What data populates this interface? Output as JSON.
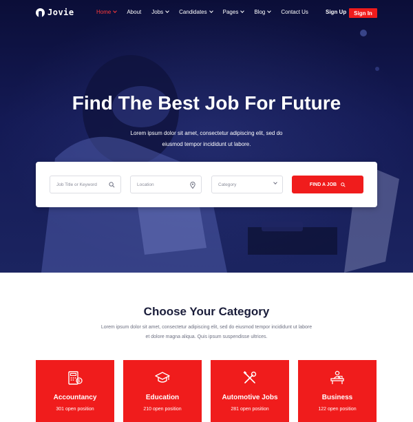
{
  "brand": {
    "name": "Jovie"
  },
  "nav": {
    "items": [
      {
        "label": "Home",
        "active": true,
        "dropdown": true
      },
      {
        "label": "About",
        "active": false,
        "dropdown": false
      },
      {
        "label": "Jobs",
        "active": false,
        "dropdown": true
      },
      {
        "label": "Candidates",
        "active": false,
        "dropdown": true
      },
      {
        "label": "Pages",
        "active": false,
        "dropdown": true
      },
      {
        "label": "Blog",
        "active": false,
        "dropdown": true
      },
      {
        "label": "Contact Us",
        "active": false,
        "dropdown": false
      }
    ],
    "signup_label": "Sign Up",
    "signin_label": "Sign In"
  },
  "hero": {
    "title": "Find The Best Job For Future",
    "subtitle_line1": "Lorem ipsum dolor sit amet, consectetur adipiscing elit, sed do",
    "subtitle_line2": "eiusmod tempor incididunt ut labore."
  },
  "search": {
    "keyword_placeholder": "Job Title or Keyword",
    "location_placeholder": "Location",
    "category_value": "Category",
    "button_label": "FIND A JOB"
  },
  "categories": {
    "title": "Choose Your Category",
    "subtitle_line1": "Lorem ipsum dolor sit amet, consectetur adipiscing elit, sed do eiusmod tempor incididunt ut labore",
    "subtitle_line2": "et dolore magna aliqua. Quis ipsum suspendisse ultrices.",
    "items": [
      {
        "name": "Accountancy",
        "count": "301 open position",
        "icon": "accounting-icon"
      },
      {
        "name": "Education",
        "count": "210 open position",
        "icon": "graduation-cap-icon"
      },
      {
        "name": "Automotive Jobs",
        "count": "281 open position",
        "icon": "wrench-screwdriver-icon"
      },
      {
        "name": "Business",
        "count": "122 open position",
        "icon": "business-desk-icon"
      }
    ]
  },
  "colors": {
    "accent": "#f01c1c",
    "hero_bg": "#141a55",
    "heading": "#1a1d3a"
  }
}
